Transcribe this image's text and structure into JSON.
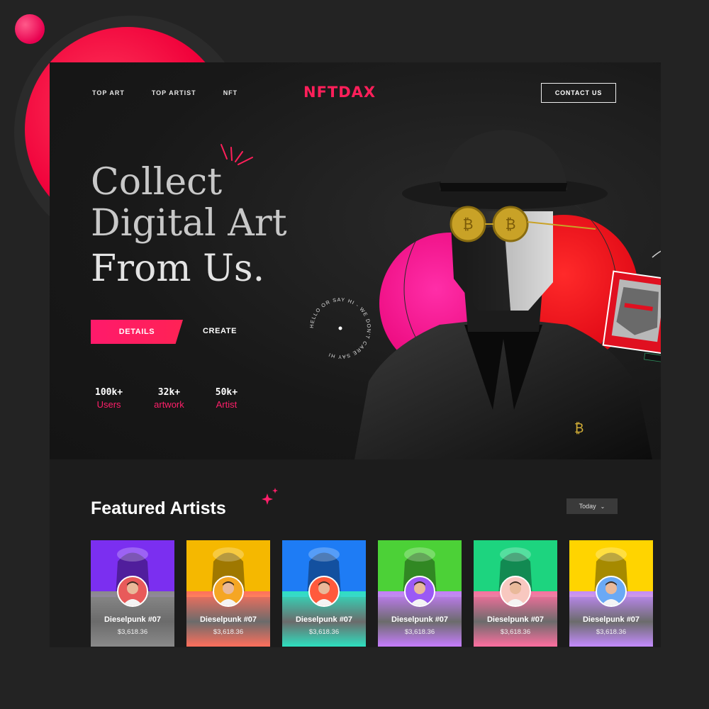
{
  "brand": {
    "logo": "NFTDAX"
  },
  "nav": {
    "items": [
      "TOP ART",
      "TOP ARTIST",
      "NFT"
    ],
    "contact_label": "CONTACT US"
  },
  "hero": {
    "headline": [
      "Collect",
      "Digital Art",
      "From Us."
    ],
    "details_label": "DETAILS",
    "create_label": "CREATE",
    "circle_text": "HELLO OR SAY HI - WE DON'T CARE SAY HI",
    "stats": [
      {
        "value": "100k+",
        "label": "Users"
      },
      {
        "value": "32k+",
        "label": "artwork"
      },
      {
        "value": "50k+",
        "label": "Artist"
      }
    ]
  },
  "featured": {
    "title": "Featured Artists",
    "filter_label": "Today",
    "cards": [
      {
        "name": "Dieselpunk #07",
        "price": "$3,618.36",
        "top": "#7b2ff0",
        "bottom": "#8a8a8a",
        "avatar_bg": "#e85a5a"
      },
      {
        "name": "Dieselpunk #07",
        "price": "$3,618.36",
        "top": "#f5b800",
        "bottom": "#ff6f5c",
        "avatar_bg": "#f5a623"
      },
      {
        "name": "Dieselpunk #07",
        "price": "$3,618.36",
        "top": "#1e7cf5",
        "bottom": "#2ee0c0",
        "avatar_bg": "#ff5a3c"
      },
      {
        "name": "Dieselpunk #07",
        "price": "$3,618.36",
        "top": "#4cd137",
        "bottom": "#c77dff",
        "avatar_bg": "#9b59f5"
      },
      {
        "name": "Dieselpunk #07",
        "price": "$3,618.36",
        "top": "#1dd47f",
        "bottom": "#ff6fa0",
        "avatar_bg": "#f8c8c0"
      },
      {
        "name": "Dieselpunk #07",
        "price": "$3,618.36",
        "top": "#ffd400",
        "bottom": "#c48bff",
        "avatar_bg": "#6aa9f5"
      }
    ]
  },
  "colors": {
    "accent": "#ff1f5a",
    "background": "#232323",
    "frame": "#141414"
  }
}
